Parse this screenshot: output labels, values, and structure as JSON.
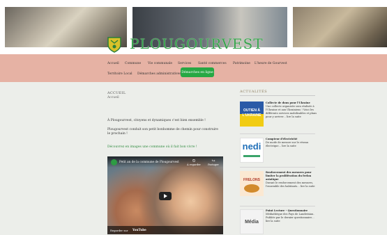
{
  "site": {
    "title": "PLOUGOURVEST"
  },
  "nav": {
    "items": [
      "Accueil",
      "Commune",
      "Vie communale",
      "Services",
      "Santé commerces",
      "Patrimoine",
      "L'heure de Gourvest",
      "Territoire Local",
      "Démarches administratives"
    ],
    "cta": "Démarches en ligne"
  },
  "page": {
    "heading": "ACCUEIL",
    "crumb": "Accueil",
    "intro": "À Plougourvest, citoyens et dynamiques c'est bien ensemble !",
    "paragraph": "Plougourvest conduit son petit bonhomme de chemin pour construire le prochain !",
    "green_line": "Découvrez en images une commune où il fait bon vivre !"
  },
  "video": {
    "title": "Petit an de la commune de Plougourvest",
    "share_later": "À regarder",
    "share": "Partager",
    "watch_on": "Regarder sur",
    "youtube": "YouTube"
  },
  "sidebar": {
    "title": "ACTUALITÉS",
    "news": [
      {
        "title": "Collecte de dons pour l'Ukraine",
        "text": "Une collecte organisée sera réalisée à l'Ukraine et aux Ukrainiens ! Voici les différents services mobilisables et plans pour y arriver… lire la suite",
        "thumb_text": "OUTIEN À L'UKRAINE"
      },
      {
        "title": "Compteur d'électricité",
        "text": "De mode de mesure sur le réseau électrique… lire la suite",
        "thumb_text": "nedi"
      },
      {
        "title": "Renforcement des mesures pour limiter la prolifération du frelon asiatique",
        "text": "Durant le renforcement des mesures, l'ensemble des habitants… lire la suite",
        "thumb_text": "FRELONS"
      },
      {
        "title": "Point Lecture – Questionnaire",
        "text": "Médiathèque des Pays de Landivisiau. Publiée par le dernier questionnaire… lire la suite",
        "thumb_text": "Média"
      }
    ]
  },
  "colors": {
    "accent": "#37a44c",
    "nav_bg": "#e6b2a4",
    "cta": "#27a844"
  }
}
